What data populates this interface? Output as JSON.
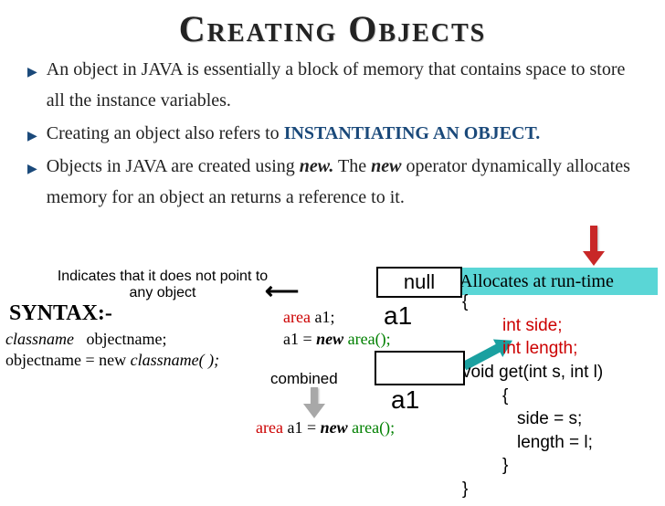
{
  "title": "Creating Objects",
  "bullets": [
    {
      "pre": "An object in JAVA is essentially a block of memory that contains space to store all the instance variables.",
      "em": "",
      "post": ""
    },
    {
      "pre": "Creating an object also refers to ",
      "em": "INSTANTIATING AN OBJECT.",
      "post": ""
    },
    {
      "pre": "Objects in JAVA are created using ",
      "em": "new.",
      "post": " The ",
      "em2": "new",
      "post2": " operator dynamically allocates memory for an object an returns a reference to it."
    }
  ],
  "note": "Indicates that it does not point to any object",
  "null_label": "null",
  "alloc_text": "Allocates at run-time",
  "syntax_label": "SYNTAX:-",
  "syntax1_classname": "classname",
  "syntax1_objectname": "objectname;",
  "syntax2": "objectname  =  new  ",
  "syntax2_call": "classname( );",
  "a1": "a1",
  "decl_area": "area ",
  "decl_a1": "a1;",
  "assign_a1": "a1 = ",
  "assign_new": "new ",
  "assign_area": "area();",
  "combined_label": "combined",
  "combined_area": "area ",
  "combined_a1": "a1 = ",
  "combined_new": "new ",
  "combined_call": "area();",
  "code": {
    "l0": "{",
    "l1": "int side;",
    "l2": "int length;",
    "l3": "void get(int s, int l)",
    "l4": "{",
    "l5": "side = s;",
    "l6": "length =  l;",
    "l7": "}",
    "l8": "}"
  }
}
